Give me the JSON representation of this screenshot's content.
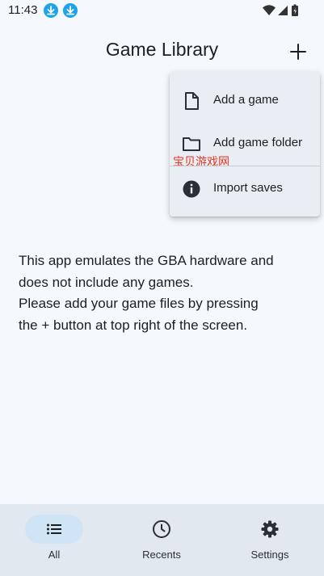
{
  "status_bar": {
    "time": "11:43"
  },
  "app_bar": {
    "title": "Game Library"
  },
  "menu": {
    "items": [
      {
        "label": "Add a game",
        "icon": "file-icon"
      },
      {
        "label": "Add game folder",
        "icon": "folder-icon"
      },
      {
        "label": "Import saves",
        "icon": "info-icon"
      }
    ],
    "watermark": "宝贝游戏网"
  },
  "message": {
    "lines": [
      "This app emulates the GBA hardware and",
      "does not include any games.",
      "Please add your game files by pressing",
      "the + button at top right of the screen."
    ]
  },
  "bottom_nav": {
    "items": [
      {
        "label": "All",
        "icon": "list-icon",
        "active": true
      },
      {
        "label": "Recents",
        "icon": "clock-icon",
        "active": false
      },
      {
        "label": "Settings",
        "icon": "gear-icon",
        "active": false
      }
    ]
  },
  "colors": {
    "background": "#f5f9fd",
    "menu_background": "#e9eef4",
    "nav_background": "#e2e8ef",
    "active_pill": "#cfe5f5",
    "download_badge": "#1fa3e8",
    "watermark": "#e8341f"
  }
}
